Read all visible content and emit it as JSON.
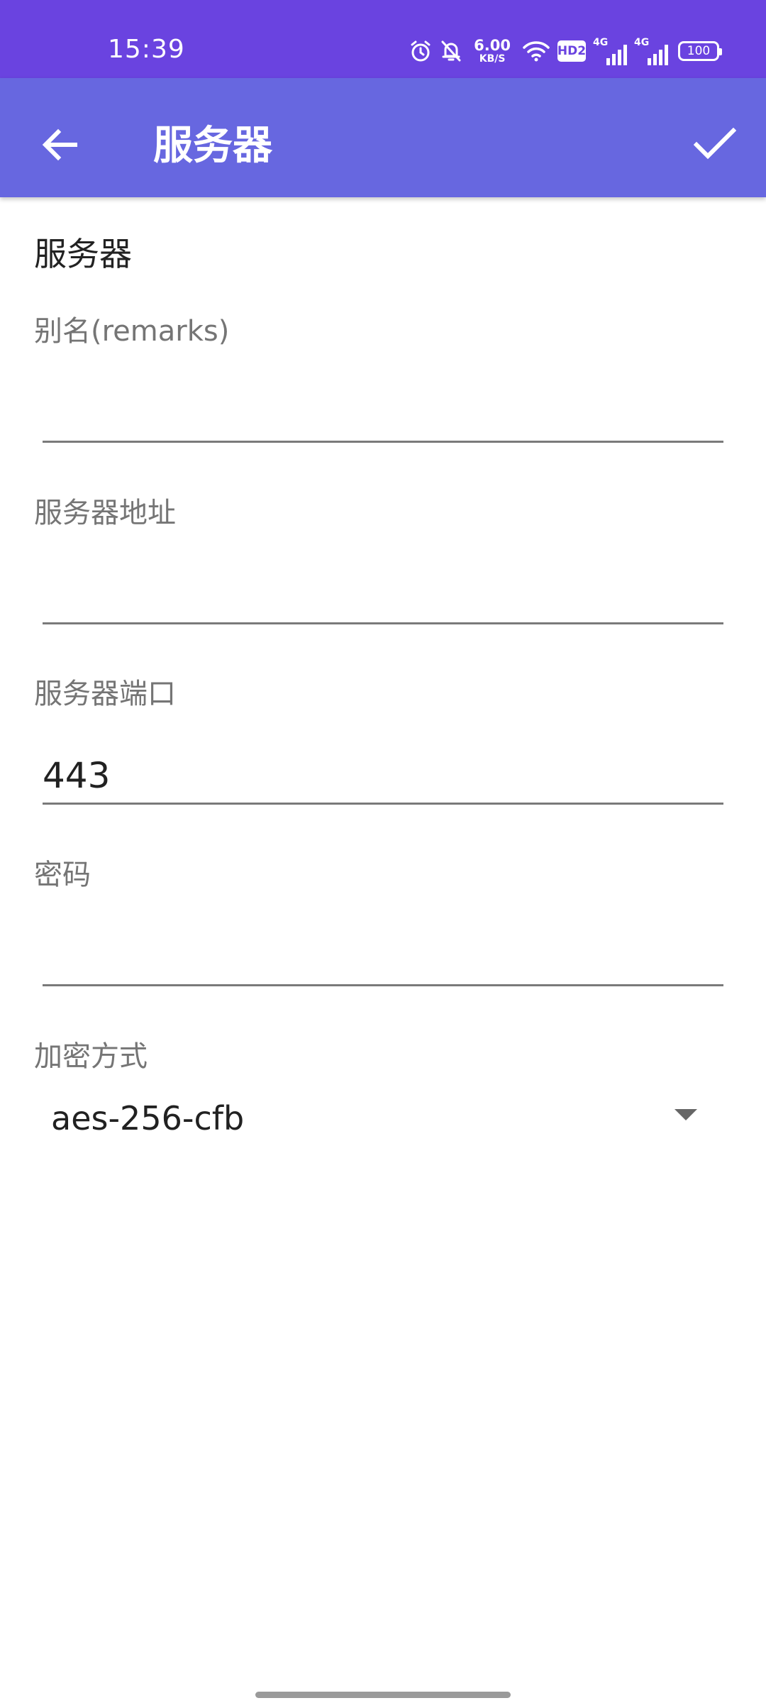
{
  "status_bar": {
    "time": "15:39",
    "net_speed_value": "6.00",
    "net_speed_unit": "KB/S",
    "hd_badge": "HD2",
    "signal1_label": "4G",
    "signal2_label": "4G",
    "battery_level": "100",
    "icons": [
      "alarm-icon",
      "mute-bell-icon",
      "wifi-icon",
      "hd-icon",
      "signal-icon",
      "signal-icon",
      "battery-icon"
    ]
  },
  "app_bar": {
    "title": "服务器",
    "back_icon": "arrow-left-icon",
    "confirm_icon": "check-icon",
    "background_color": "#6767e0"
  },
  "form": {
    "section_title": "服务器",
    "fields": [
      {
        "label": "别名(remarks)",
        "value": "",
        "placeholder": ""
      },
      {
        "label": "服务器地址",
        "value": "",
        "placeholder": ""
      },
      {
        "label": "服务器端口",
        "value": "443",
        "placeholder": ""
      },
      {
        "label": "密码",
        "value": "",
        "placeholder": ""
      }
    ],
    "encryption": {
      "label": "加密方式",
      "selected": "aes-256-cfb"
    }
  },
  "colors": {
    "status_bar": "#6a43e0",
    "label_text": "#757575",
    "input_text": "#212121"
  }
}
